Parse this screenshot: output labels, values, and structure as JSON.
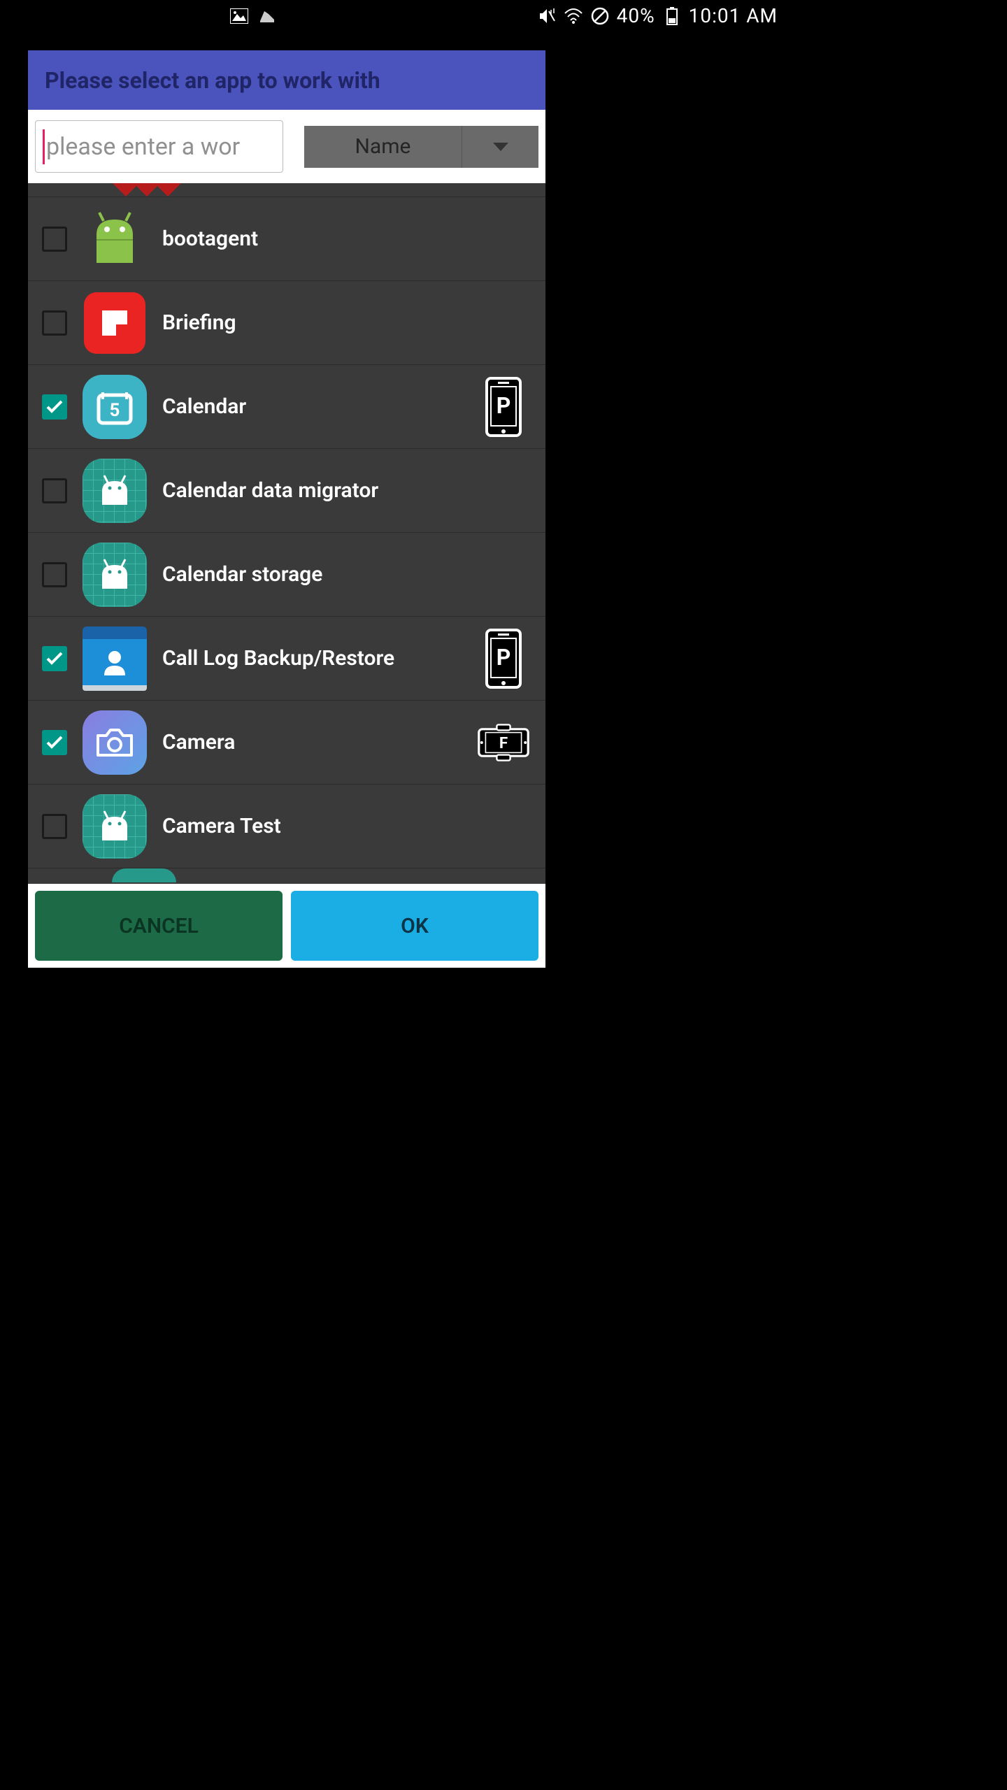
{
  "status": {
    "battery_pct": "40%",
    "time": "10:01 AM"
  },
  "dialog": {
    "title": "Please select an app to work with"
  },
  "search": {
    "placeholder": "please enter a wor",
    "value": ""
  },
  "sort": {
    "selected": "Name"
  },
  "apps": [
    {
      "name": "bootagent",
      "checked": false,
      "icon": "android",
      "badge": null
    },
    {
      "name": "Briefing",
      "checked": false,
      "icon": "briefing",
      "badge": null
    },
    {
      "name": "Calendar",
      "checked": true,
      "icon": "calendar",
      "badge": "P"
    },
    {
      "name": "Calendar data migrator",
      "checked": false,
      "icon": "grid-android",
      "badge": null
    },
    {
      "name": "Calendar storage",
      "checked": false,
      "icon": "grid-android",
      "badge": null
    },
    {
      "name": "Call Log Backup/Restore",
      "checked": true,
      "icon": "contacts",
      "badge": "P"
    },
    {
      "name": "Camera",
      "checked": true,
      "icon": "camera",
      "badge": "F"
    },
    {
      "name": "Camera Test",
      "checked": false,
      "icon": "grid-android",
      "badge": null
    }
  ],
  "buttons": {
    "cancel": "CANCEL",
    "ok": "OK"
  }
}
